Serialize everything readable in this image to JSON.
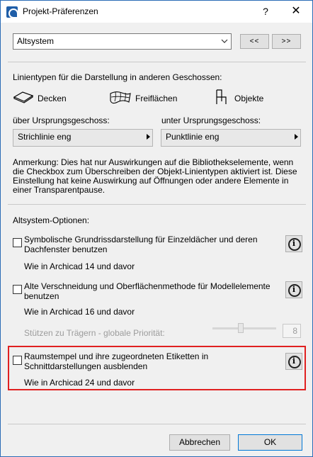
{
  "window": {
    "title": "Projekt-Präferenzen",
    "help_label": "?",
    "close_label": "✕"
  },
  "preset": {
    "selected": "Altsystem",
    "prev_label": "<<",
    "next_label": ">>"
  },
  "linetypes": {
    "heading": "Linientypen für die Darstellung in anderen Geschossen:",
    "items": [
      {
        "label": "Decken",
        "icon": "slab-icon"
      },
      {
        "label": "Freiflächen",
        "icon": "mesh-icon"
      },
      {
        "label": "Objekte",
        "icon": "chair-icon"
      }
    ],
    "above_label": "über Ursprungsgeschoss:",
    "below_label": "unter Ursprungsgeschoss:",
    "above_value": "Strichlinie eng",
    "below_value": "Punktlinie eng",
    "note": "Anmerkung: Dies hat nur Auswirkungen auf die Bibliothekselemente, wenn die Checkbox zum Überschreiben der Objekt-Linientypen aktiviert ist. Diese Einstellung hat keine Auswirkung auf Öffnungen oder andere Elemente in einer Transparentpause."
  },
  "legacy": {
    "heading": "Altsystem-Optionen:",
    "option1": {
      "label": "Symbolische Grundrissdarstellung für Einzeldächer und deren Dachfenster benutzen",
      "checked": false,
      "note": "Wie in Archicad 14 und davor"
    },
    "option2": {
      "label": "Alte Verschneidung und Oberflächenmethode für Modellelemente benutzen",
      "checked": false,
      "note": "Wie in Archicad 16 und davor",
      "priority_label": "Stützen zu Trägern - globale Priorität:",
      "priority_value": "8",
      "priority_slider_fraction": 0.44
    },
    "option3": {
      "label": "Raumstempel und ihre zugeordneten Etiketten in Schnittdarstellungen ausblenden",
      "checked": false,
      "note": "Wie in Archicad 24 und davor"
    },
    "info_label": "i"
  },
  "footer": {
    "cancel_label": "Abbrechen",
    "ok_label": "OK"
  },
  "colors": {
    "highlight": "#e02020",
    "window_border": "#2b6cb6"
  }
}
